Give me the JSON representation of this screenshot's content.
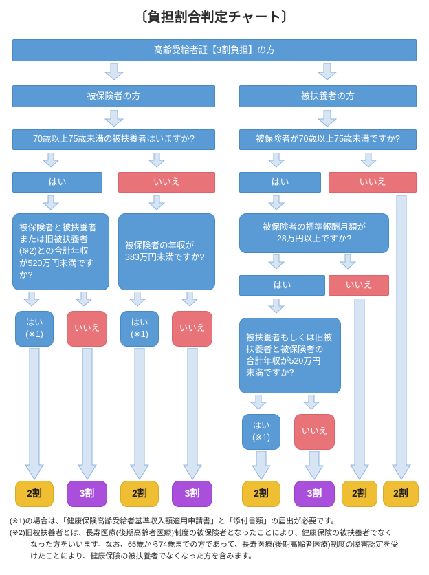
{
  "title": "〔負担割合判定チャート〕",
  "colors": {
    "blue": "#5b9bd5",
    "red": "#e8747a",
    "yellow": "#efbe33",
    "purple": "#a94fdb",
    "arrow_fill": "#d6e4f4",
    "arrow_stroke": "#8db3dd",
    "text_dark": "#231f20",
    "text_light": "#ffffff"
  },
  "nodes": {
    "root": "高齢受給者証【3割負担】の方",
    "left_branch": {
      "header": "被保険者の方",
      "question": "70歳以上75歳未満の被扶養者はいますか?",
      "answer_yes": "はい",
      "answer_no": "いいえ",
      "question_yes_path": "被保険者と被扶養者\nまたは旧被扶養者\n(※2)との合計年収\nが520万円未満です\nか?",
      "question_no_path": "被保険者の年収が\n383万円未満ですか?",
      "leaf_yes_1": "はい\n(※1)",
      "leaf_no_1": "いいえ",
      "leaf_yes_2": "はい\n(※1)",
      "leaf_no_2": "いいえ"
    },
    "right_branch": {
      "header": "被扶養者の方",
      "question": "被保険者が70歳以上75歳未満ですか?",
      "answer_yes": "はい",
      "answer_no": "いいえ",
      "question_2": "被保険者の標準報酬月額が\n28万円以上ですか?",
      "answer_yes_2": "はい",
      "answer_no_2": "いいえ",
      "question_3": "被扶養者もしくは旧被\n扶養者と被保険者の\n合計年収が520万円\n未満ですか?",
      "leaf_yes_3": "はい\n(※1)",
      "leaf_no_3": "いいえ"
    }
  },
  "results": [
    {
      "label": "2割",
      "color": "yellow"
    },
    {
      "label": "3割",
      "color": "purple"
    },
    {
      "label": "2割",
      "color": "yellow"
    },
    {
      "label": "3割",
      "color": "purple"
    },
    {
      "label": "2割",
      "color": "yellow"
    },
    {
      "label": "3割",
      "color": "purple"
    },
    {
      "label": "2割",
      "color": "yellow"
    },
    {
      "label": "2割",
      "color": "yellow"
    }
  ],
  "notes": [
    "(※1)の場合は、「健康保険高齢受給者基準収入額適用申請書」と「添付書類」の届出が必要です。",
    "(※2)旧被扶養者とは、長寿医療(後期高齢者医療)制度の被保険者となったことにより、健康保険の被扶養者でなく",
    "なった方をいいます。なお、65歳から74歳までの方であって、長寿医療(後期高齢者医療)制度の障害認定を受",
    "けたことにより、健康保険の被扶養者でなくなった方を含みます。"
  ]
}
